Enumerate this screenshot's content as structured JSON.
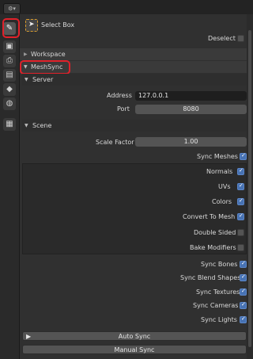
{
  "toolbar": {
    "tool_label": "Select Box",
    "deselect_label": "Deselect"
  },
  "sidebar": {
    "icons": [
      "tool-icon",
      "render-icon",
      "output-icon",
      "view-layer-icon",
      "scene-icon",
      "world-icon",
      "texture-icon"
    ]
  },
  "panels": {
    "workspace": "Workspace",
    "meshsync": "MeshSync",
    "server": {
      "title": "Server",
      "address_label": "Address",
      "address_value": "127.0.0.1",
      "port_label": "Port",
      "port_value": "8080"
    },
    "scene": {
      "title": "Scene",
      "scale_label": "Scale Factor",
      "scale_value": "1.00",
      "sync_meshes": "Sync Meshes",
      "normals": "Normals",
      "uvs": "UVs",
      "colors": "Colors",
      "convert_to_mesh": "Convert To Mesh",
      "double_sided": "Double Sided",
      "bake_modifiers": "Bake Modifiers",
      "sync_bones": "Sync Bones",
      "sync_blend_shapes": "Sync Blend Shapes",
      "sync_textures": "Sync Textures",
      "sync_cameras": "Sync Cameras",
      "sync_lights": "Sync Lights"
    },
    "auto_sync": "Auto Sync",
    "manual_sync": "Manual Sync"
  },
  "checks": {
    "sync_meshes": true,
    "normals": true,
    "uvs": true,
    "colors": true,
    "convert_to_mesh": true,
    "double_sided": false,
    "bake_modifiers": false,
    "sync_bones": true,
    "sync_blend_shapes": true,
    "sync_textures": true,
    "sync_cameras": true,
    "sync_lights": true
  },
  "colors": {
    "highlight": "#e0212a",
    "checkbox": "#4772b3"
  }
}
